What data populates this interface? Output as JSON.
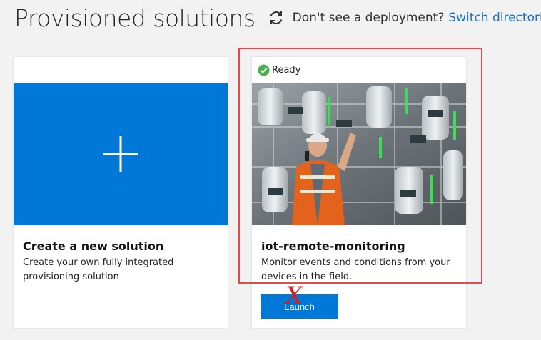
{
  "header": {
    "title": "Provisioned solutions",
    "hint": "Don't see a deployment?",
    "switch_link": "Switch directories",
    "refresh_icon": "refresh-icon"
  },
  "cards": [
    {
      "title": "Create a new solution",
      "description": "Create your own fully integrated provisioning solution",
      "icon": "plus-icon",
      "tile_color": "#0078d7"
    },
    {
      "status": "Ready",
      "status_icon": "checkmark-circle-icon",
      "status_color": "#4caf50",
      "title": "iot-remote-monitoring",
      "description": "Monitor events and conditions from your devices in the field.",
      "launch_label": "Launch"
    }
  ],
  "annotations": {
    "highlight_color": "#e8474a",
    "x_mark": "X"
  }
}
